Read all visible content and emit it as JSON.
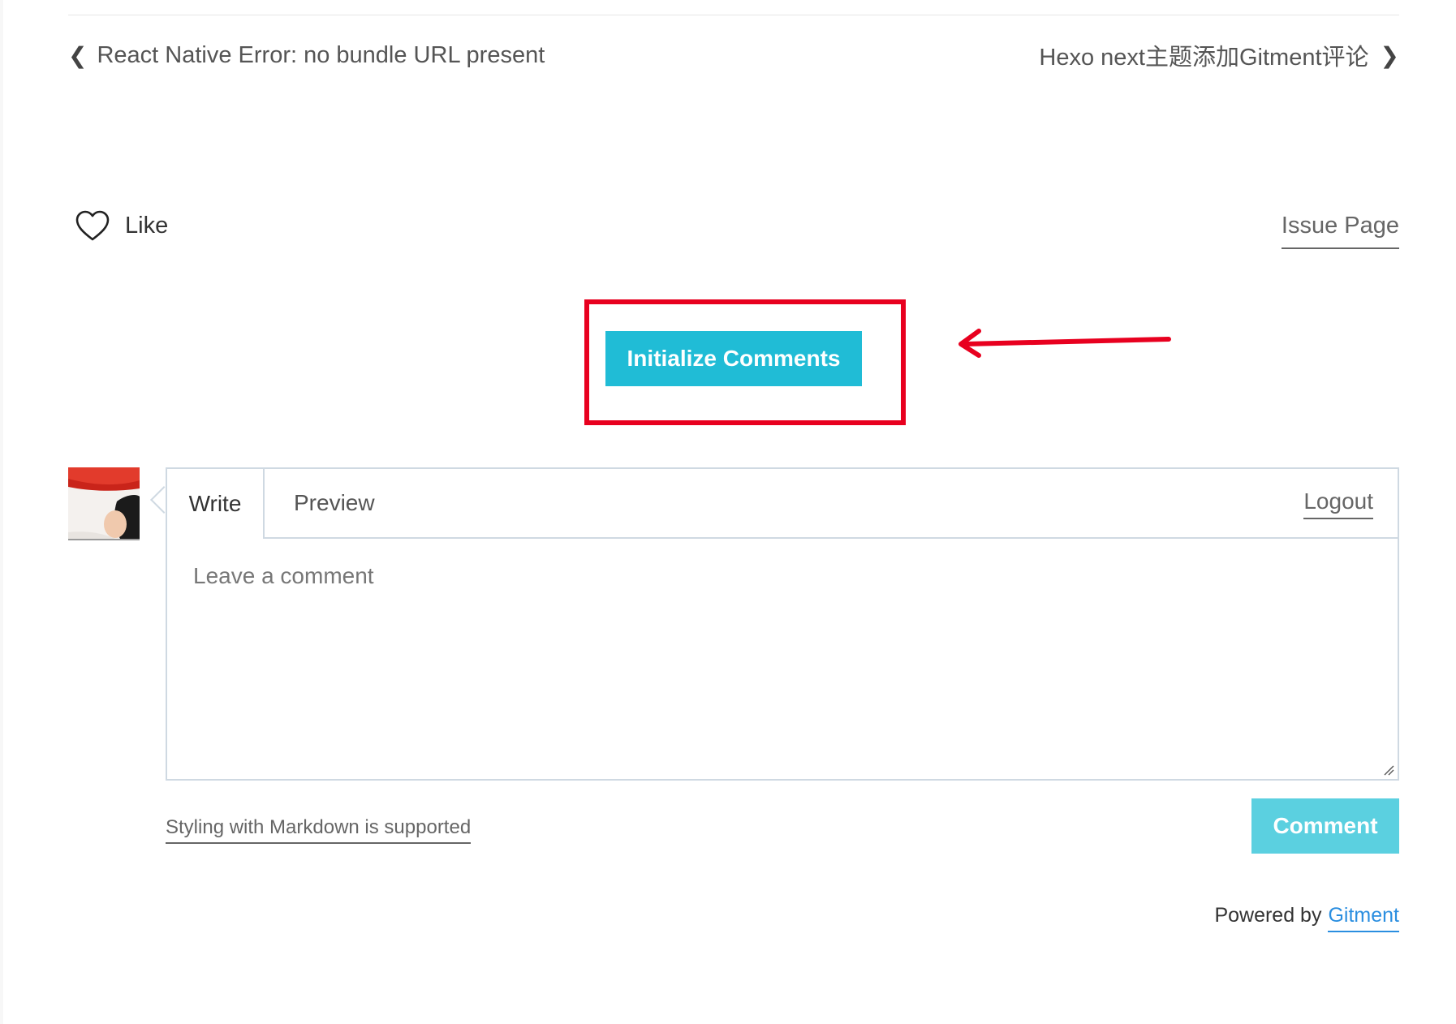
{
  "post_nav": {
    "prev_label": "React Native Error: no bundle URL present",
    "next_label": "Hexo next主题添加Gitment评论"
  },
  "reactions": {
    "like_label": "Like"
  },
  "issue_link": {
    "label": "Issue Page"
  },
  "init": {
    "button_label": "Initialize Comments"
  },
  "editor": {
    "tabs": [
      {
        "label": "Write",
        "active": true
      },
      {
        "label": "Preview",
        "active": false
      }
    ],
    "logout_label": "Logout",
    "placeholder": "Leave a comment",
    "value": ""
  },
  "footer": {
    "markdown_note": "Styling with Markdown is supported",
    "comment_button": "Comment",
    "powered_by": "Powered by",
    "powered_link": "Gitment"
  },
  "colors": {
    "primary_button": "#20bcd6",
    "comment_button": "#5bd0e0",
    "highlight_annotation": "#e8001f",
    "link_blue": "#2a8ee0"
  },
  "icons": [
    "chevron-left-icon",
    "chevron-right-icon",
    "heart-icon",
    "annotation-arrow-icon",
    "resize-grip-icon"
  ]
}
